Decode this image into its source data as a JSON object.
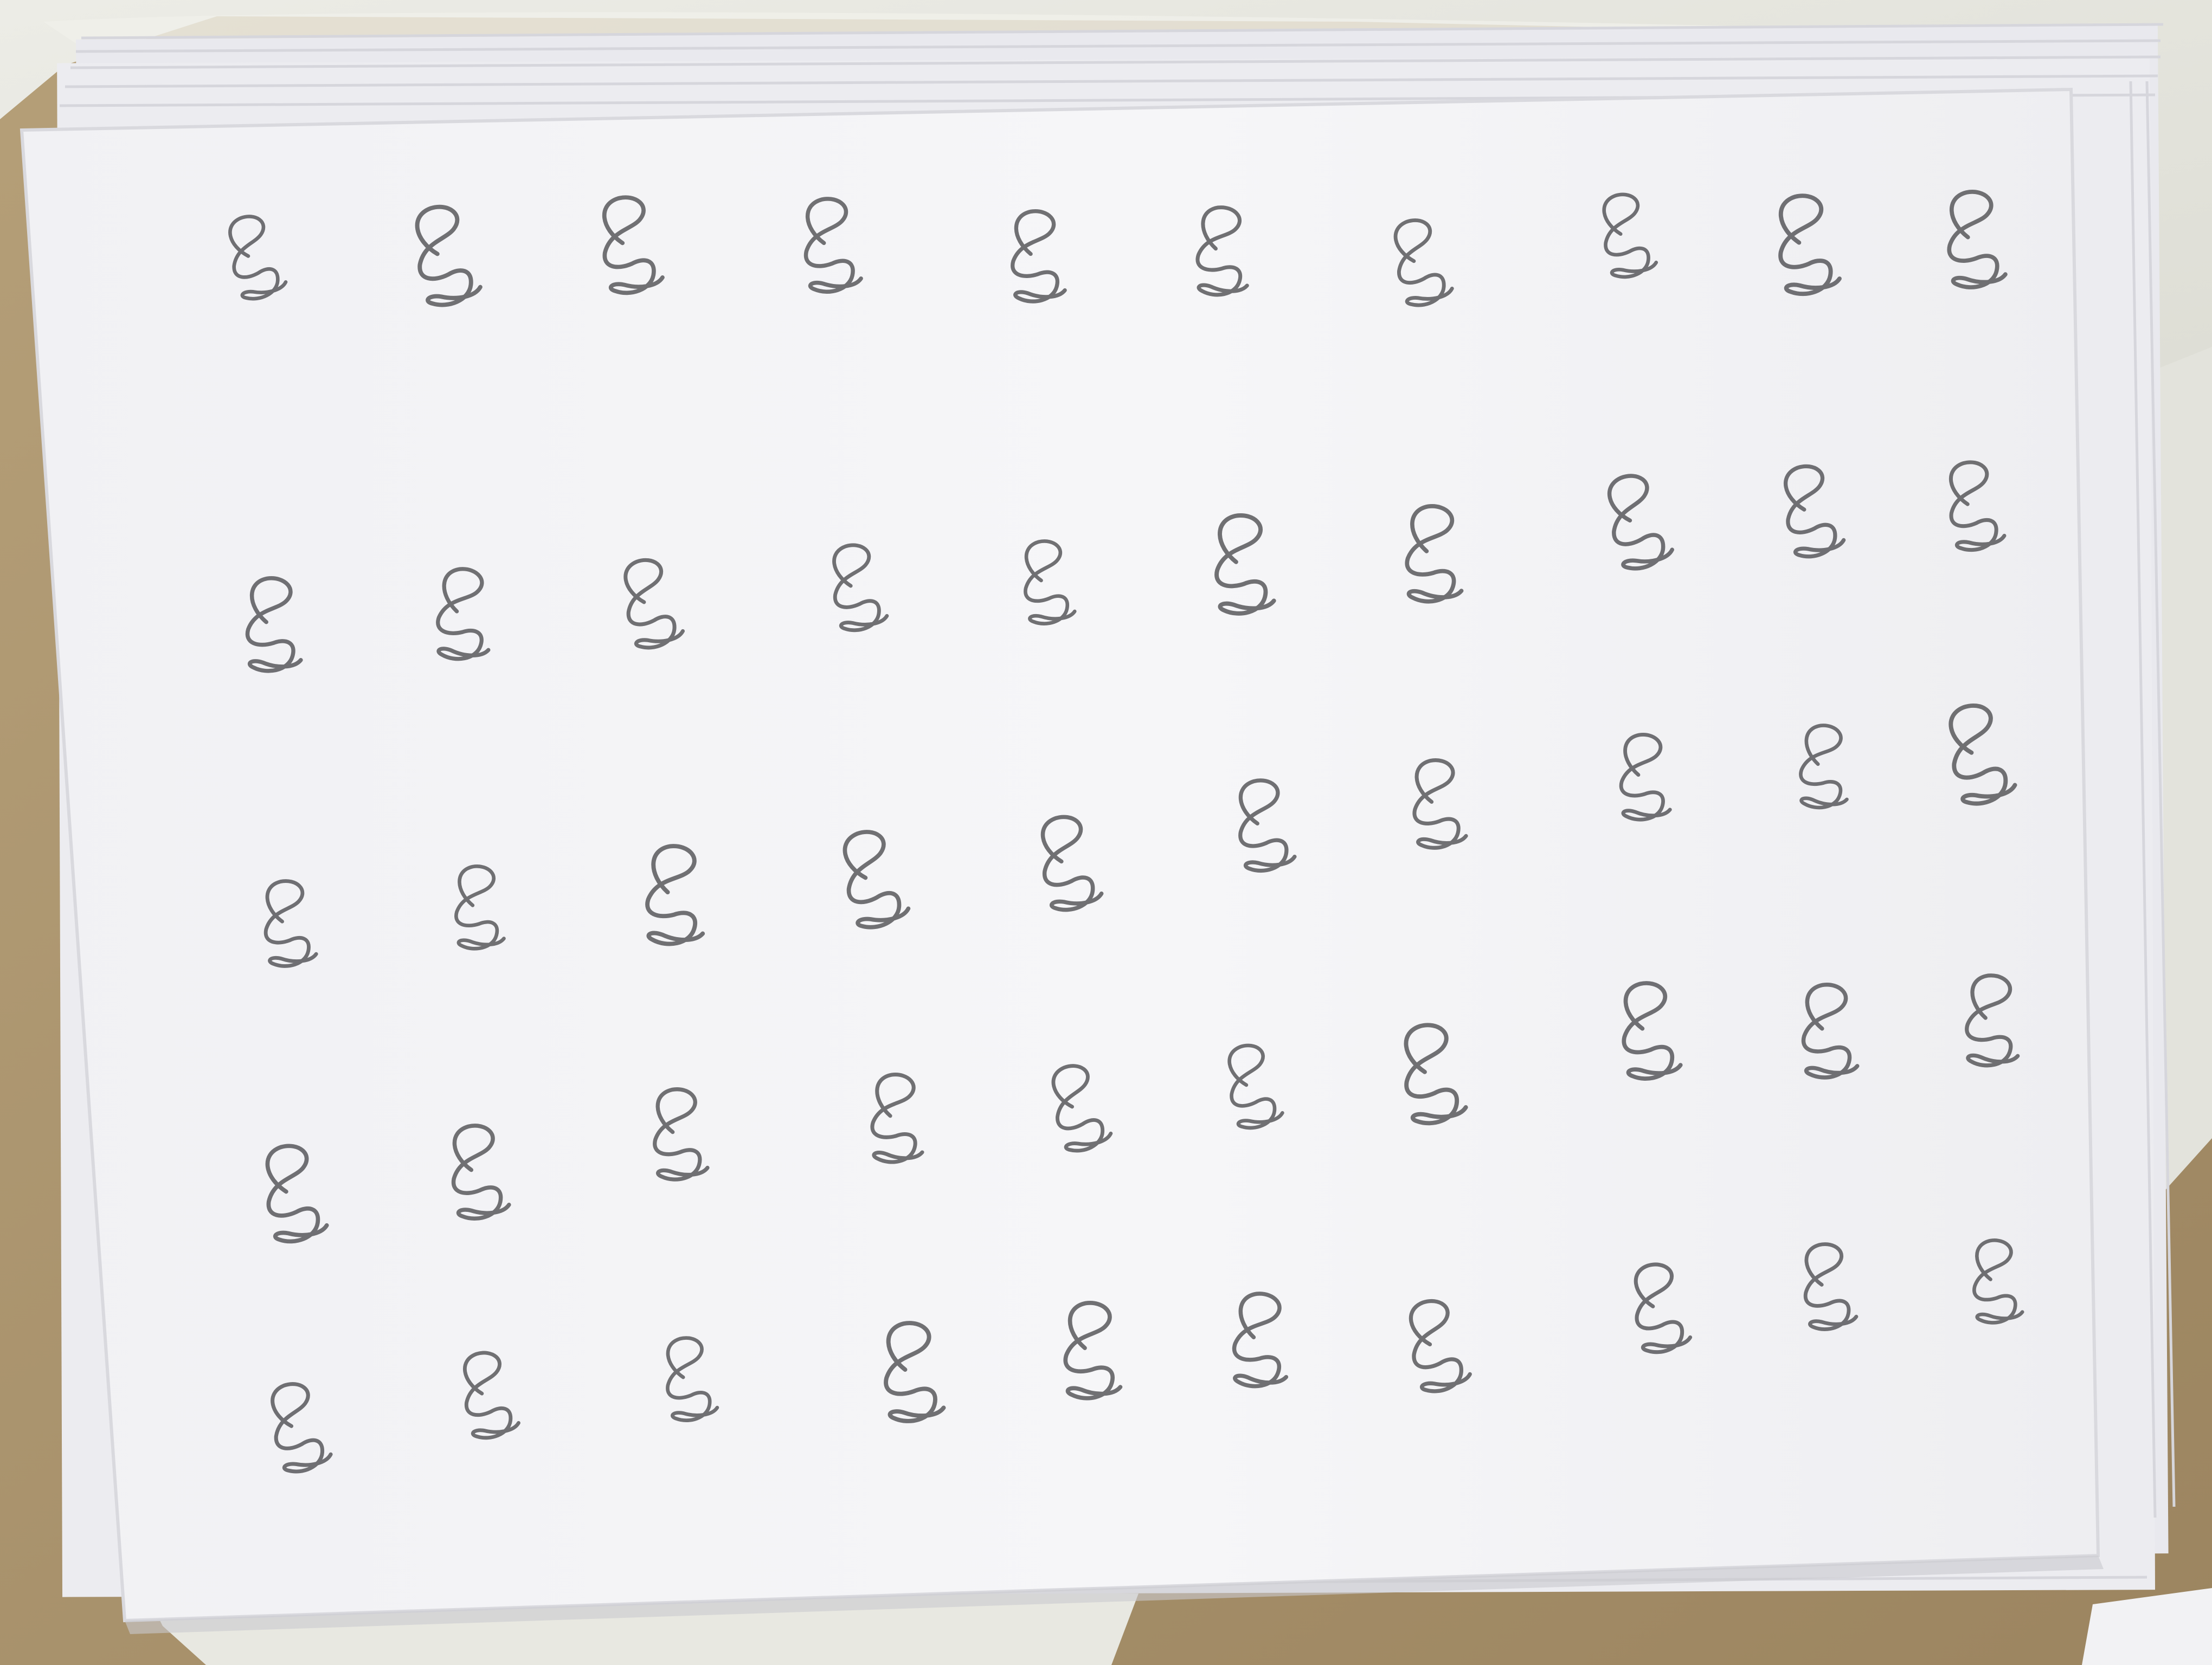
{
  "photo": {
    "colors": {
      "cardboard": "#a8916a",
      "plastic_wrap": "#e6e6df",
      "paper": "#f4f4f6",
      "paper_shadow": "#d9d9de",
      "pencil": "#58585c"
    },
    "sheet": {
      "rows": 5,
      "columns": 10,
      "character": "handwritten-glyph",
      "medium": "pencil",
      "count": 50
    }
  }
}
